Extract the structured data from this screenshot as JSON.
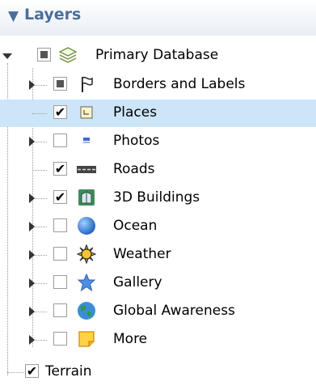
{
  "panel": {
    "title": "Layers",
    "collapse_glyph": "▼"
  },
  "tree": {
    "check_glyph": "✔",
    "root": {
      "label": "Primary Database",
      "state": "partial",
      "icon": "database-layers-icon"
    },
    "items": [
      {
        "label": "Borders and Labels",
        "state": "partial",
        "icon": "flag-icon",
        "expandable": true
      },
      {
        "label": "Places",
        "state": "checked",
        "icon": "places-icon",
        "expandable": false,
        "selected": true
      },
      {
        "label": "Photos",
        "state": "unchecked",
        "icon": "photos-icon",
        "expandable": true
      },
      {
        "label": "Roads",
        "state": "checked",
        "icon": "roads-icon",
        "expandable": false
      },
      {
        "label": "3D Buildings",
        "state": "checked",
        "icon": "buildings-icon",
        "expandable": true
      },
      {
        "label": "Ocean",
        "state": "unchecked",
        "icon": "ocean-globe-icon",
        "expandable": true
      },
      {
        "label": "Weather",
        "state": "unchecked",
        "icon": "weather-sun-icon",
        "expandable": true
      },
      {
        "label": "Gallery",
        "state": "unchecked",
        "icon": "gallery-star-icon",
        "expandable": true
      },
      {
        "label": "Global Awareness",
        "state": "unchecked",
        "icon": "global-awareness-icon",
        "expandable": true
      },
      {
        "label": "More",
        "state": "unchecked",
        "icon": "more-note-icon",
        "expandable": true
      }
    ],
    "terrain": {
      "label": "Terrain",
      "state": "checked"
    }
  }
}
